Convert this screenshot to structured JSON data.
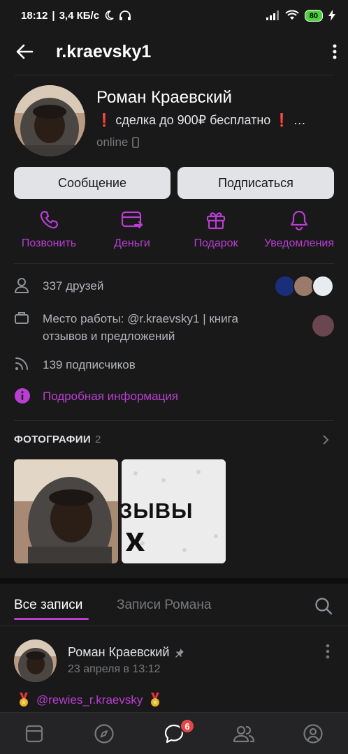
{
  "status_bar": {
    "time": "18:12",
    "network_speed": "3,4 КБ/с",
    "battery": "80"
  },
  "header": {
    "title": "r.kraevsky1"
  },
  "profile": {
    "name": "Роман Краевский",
    "status": "❗ сделка до 900₽ бесплатно ❗ …",
    "online": "online"
  },
  "buttons": {
    "message": "Сообщение",
    "subscribe": "Подписаться"
  },
  "actions": {
    "call": "Позвонить",
    "money": "Деньги",
    "gift": "Подарок",
    "notifications": "Уведомления"
  },
  "info": {
    "friends": "337 друзей",
    "work_line1": "Место работы: @r.kraevsky1 | книга",
    "work_line2": "отзывов и предложений",
    "followers": "139 подписчиков",
    "details": "Подробная информация"
  },
  "photos": {
    "title": "ФОТОГРАФИИ",
    "count": "2",
    "photo2_text_line1": "ЗЫВЫ"
  },
  "tabs": {
    "all_posts": "Все записи",
    "roman_posts": "Записи Романа"
  },
  "post": {
    "author": "Роман Краевский",
    "date": "23 апреля в 13:12",
    "text": "@rewies_r.kraevsky"
  },
  "bottom_nav": {
    "messages_badge": "6"
  },
  "colors": {
    "accent": "#b93ed1",
    "background": "#19191a",
    "button_bg": "#e1e3e6",
    "badge": "#e64646"
  }
}
